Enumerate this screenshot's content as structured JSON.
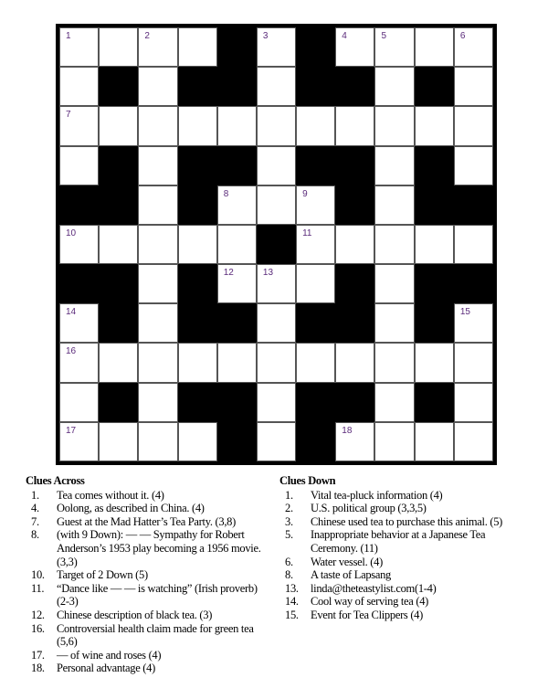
{
  "puzzle": {
    "grid": [
      "WWWW#W#WWWW",
      "W#W##W##W#W",
      "WWWWWWWWWWW",
      "W#W##W##W#W",
      "##W#WWW#W##",
      "WWWWW#WWWWW",
      "##W#WWW#W##",
      "W#W##W##W#W",
      "WWWWWWWWWWW",
      "W#W##W##W#W",
      "WWWW#W#WWWW"
    ],
    "numbers": [
      {
        "row": 0,
        "col": 0,
        "n": "1"
      },
      {
        "row": 0,
        "col": 2,
        "n": "2"
      },
      {
        "row": 0,
        "col": 5,
        "n": "3"
      },
      {
        "row": 0,
        "col": 7,
        "n": "4"
      },
      {
        "row": 0,
        "col": 8,
        "n": "5"
      },
      {
        "row": 0,
        "col": 10,
        "n": "6"
      },
      {
        "row": 2,
        "col": 0,
        "n": "7"
      },
      {
        "row": 4,
        "col": 4,
        "n": "8"
      },
      {
        "row": 4,
        "col": 6,
        "n": "9"
      },
      {
        "row": 5,
        "col": 0,
        "n": "10"
      },
      {
        "row": 5,
        "col": 6,
        "n": "11"
      },
      {
        "row": 6,
        "col": 4,
        "n": "12"
      },
      {
        "row": 6,
        "col": 5,
        "n": "13"
      },
      {
        "row": 7,
        "col": 0,
        "n": "14"
      },
      {
        "row": 7,
        "col": 10,
        "n": "15"
      },
      {
        "row": 8,
        "col": 0,
        "n": "16"
      },
      {
        "row": 10,
        "col": 0,
        "n": "17"
      },
      {
        "row": 10,
        "col": 7,
        "n": "18"
      }
    ]
  },
  "across": {
    "title": "Clues Across",
    "clues": [
      {
        "num": "1.",
        "text": "Tea comes without it. (4)"
      },
      {
        "num": "4.",
        "text": "Oolong, as described in China. (4)"
      },
      {
        "num": "7.",
        "text": "Guest at the Mad Hatter’s Tea Party. (3,8)"
      },
      {
        "num": "8.",
        "text": "(with 9 Down): — — Sympathy for Robert Anderson’s 1953 play becoming a 1956 movie. (3,3)"
      },
      {
        "num": "10.",
        "text": "Target of 2 Down (5)"
      },
      {
        "num": "11.",
        "text": "“Dance like — — is watching” (Irish proverb)  (2-3)"
      },
      {
        "num": "12.",
        "text": "Chinese description of black tea. (3)"
      },
      {
        "num": "16.",
        "text": "Controversial health claim made for green tea (5,6)"
      },
      {
        "num": "17.",
        "text": "— of wine and roses (4)"
      },
      {
        "num": "18.",
        "text": "Personal advantage (4)"
      }
    ]
  },
  "down": {
    "title": "Clues Down",
    "clues": [
      {
        "num": "1.",
        "text": "Vital tea-pluck information (4)"
      },
      {
        "num": "2.",
        "text": "U.S. political group (3,3,5)"
      },
      {
        "num": "3.",
        "text": "Chinese used tea to purchase this animal. (5)"
      },
      {
        "num": "5.",
        "text": "Inappropriate  behavior at a Japanese Tea Ceremony. (11)"
      },
      {
        "num": "6.",
        "text": "Water vessel. (4)"
      },
      {
        "num": "8.",
        "text": "A taste of Lapsang"
      },
      {
        "num": "13.",
        "text": "linda@theteastylist.com(1-4)"
      },
      {
        "num": "14.",
        "text": "Cool way of serving tea (4)"
      },
      {
        "num": "15.",
        "text": "Event for Tea Clippers (4)"
      }
    ]
  }
}
